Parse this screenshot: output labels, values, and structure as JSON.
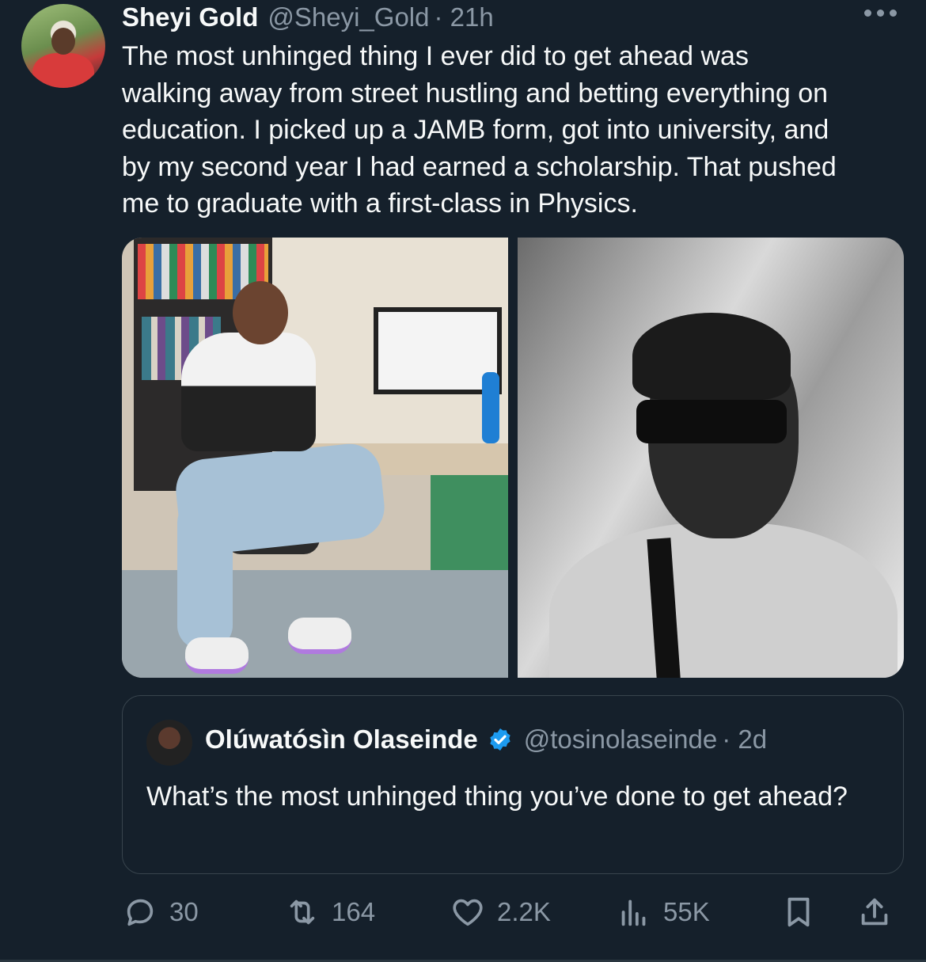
{
  "tweet": {
    "author_name": "Sheyi Gold",
    "author_handle": "@Sheyi_Gold",
    "time": "· 21h",
    "text": "The most unhinged thing I ever did to get ahead was\nwalking away from street hustling and betting everything on\neducation. I picked up a JAMB form, got into university, and\nby my second year I had earned a scholarship. That pushed\nme to graduate with a first-class in Physics."
  },
  "quoted": {
    "author_name": "Olúwatósìn Olaseinde",
    "author_handle": "@tosinolaseinde",
    "time": "· 2d",
    "text": "What’s the most unhinged thing you’ve done to get ahead?"
  },
  "actions": {
    "replies": "30",
    "reposts": "164",
    "likes": "2.2K",
    "views": "55K"
  },
  "colors": {
    "background": "#15202b",
    "text": "#f7f9f9",
    "muted": "#8b98a5",
    "verified": "#1d9bf0"
  }
}
